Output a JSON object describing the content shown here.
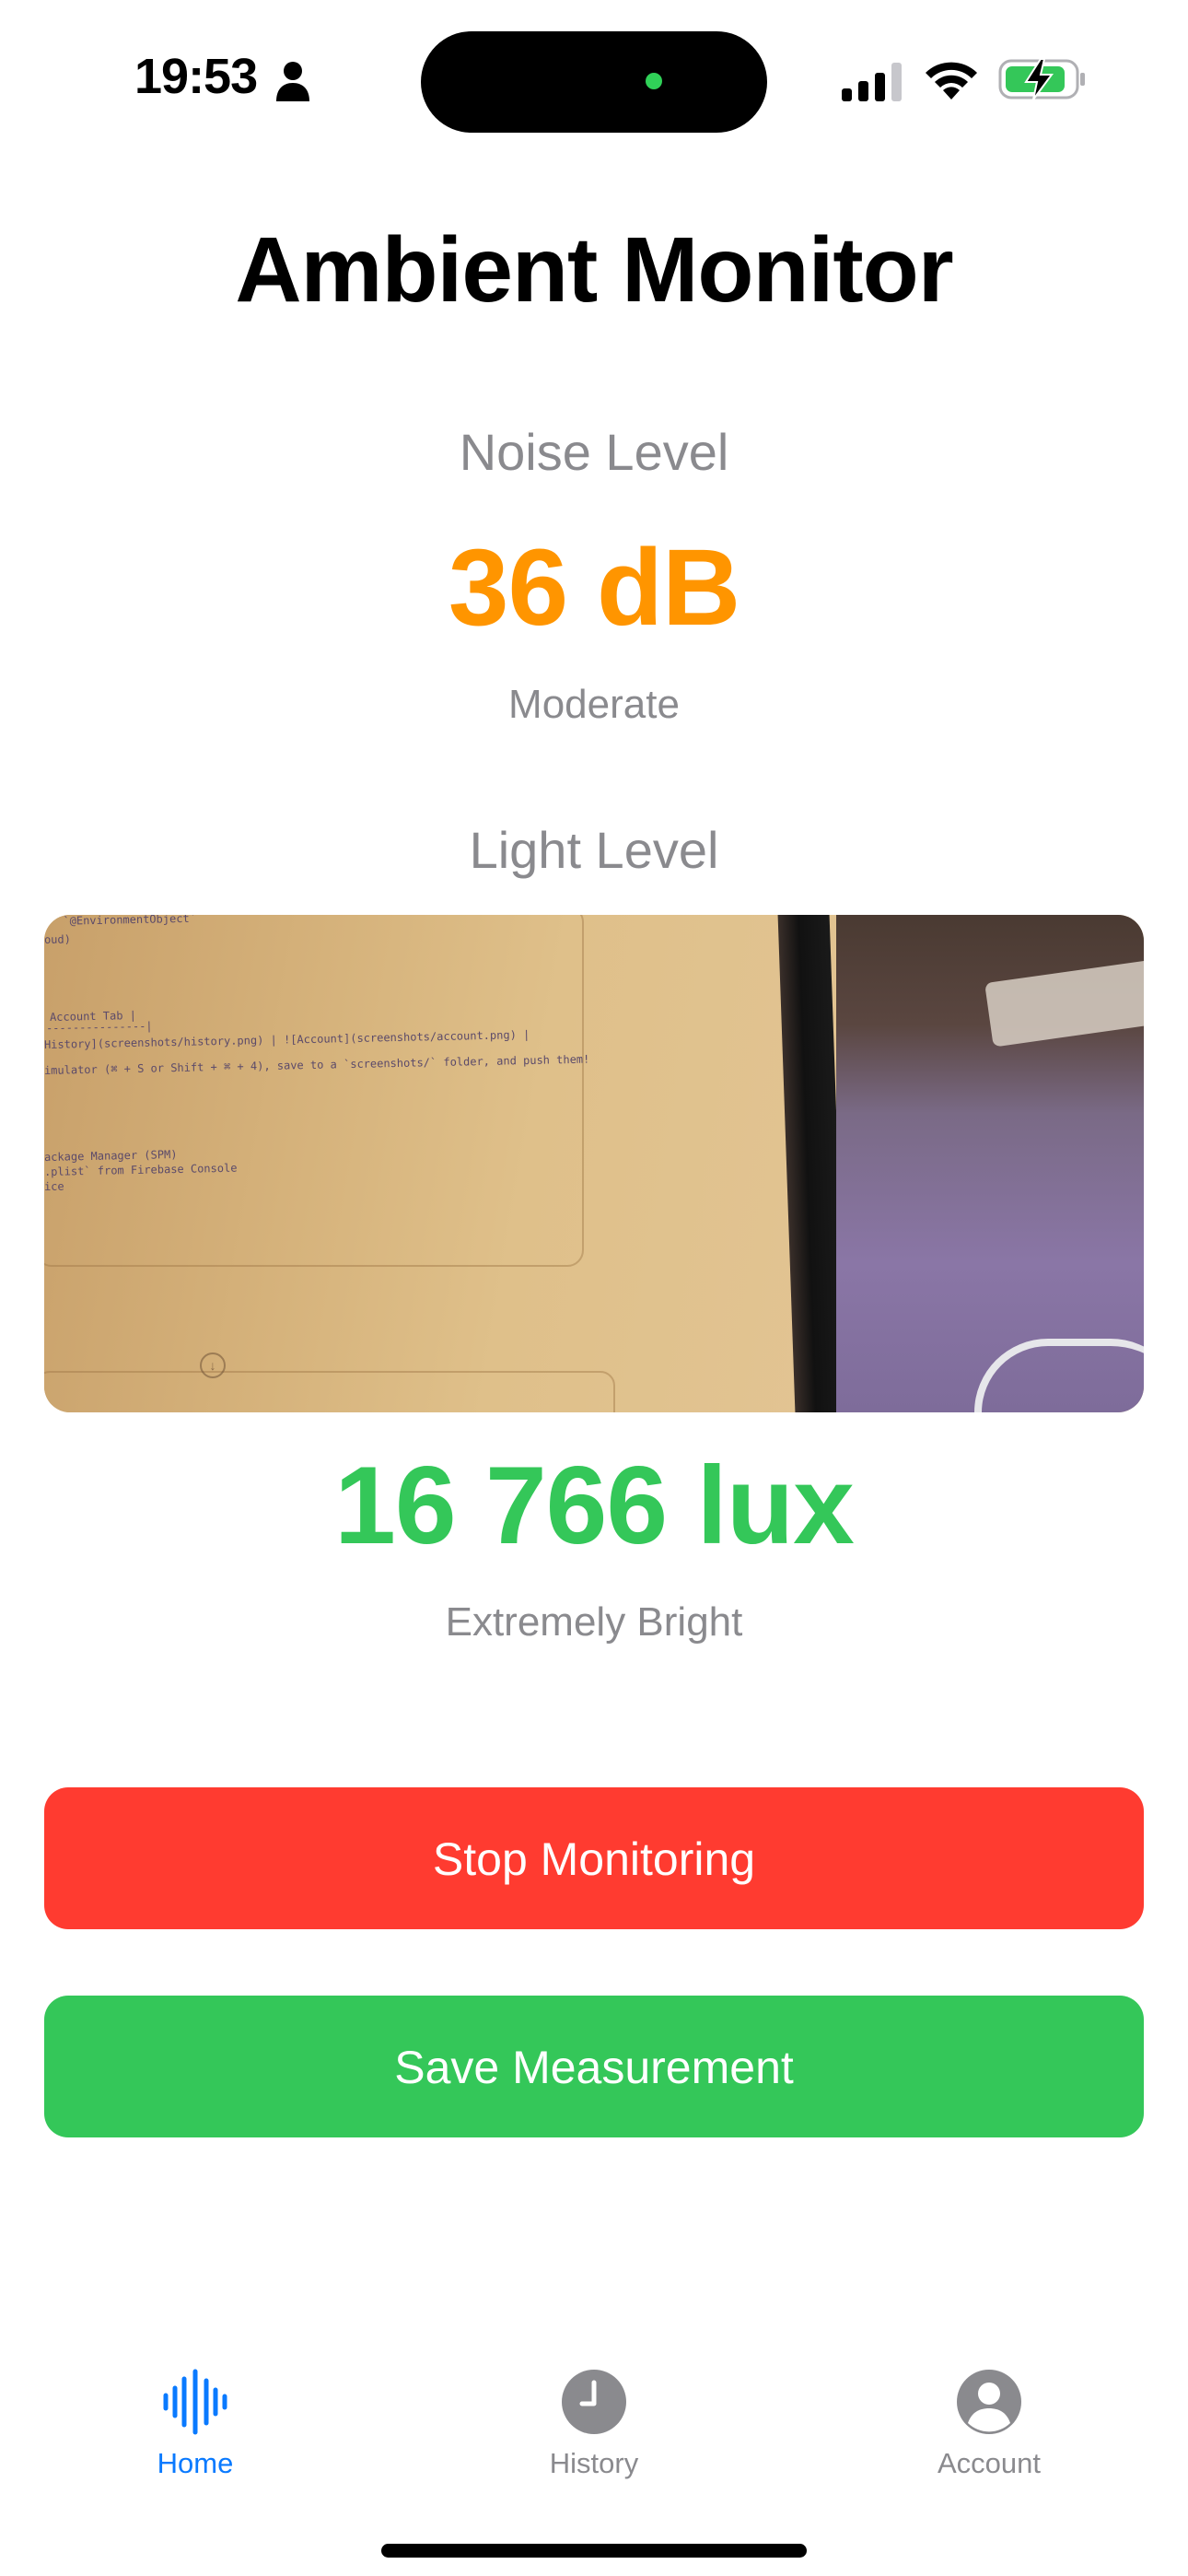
{
  "status_bar": {
    "time": "19:53",
    "icons": [
      "person-icon",
      "cellular-signal-icon",
      "wifi-icon",
      "battery-charging-icon"
    ]
  },
  "header": {
    "title": "Ambient Monitor"
  },
  "noise": {
    "label": "Noise Level",
    "value": "36 dB",
    "description": "Moderate",
    "color": "#ff9500"
  },
  "light": {
    "label": "Light Level",
    "value": "16 766 lux",
    "description": "Extremely Bright",
    "color": "#34c759"
  },
  "camera_preview": {
    "code_lines": [
      "` `@EnvironmentObject`",
      "oud)",
      "Account Tab |",
      "---------------|",
      "History](screenshots/history.png) | ![Account](screenshots/account.png) |",
      "imulator (⌘ + S or Shift + ⌘ + 4), save to a `screenshots/` folder, and push them!",
      "ackage Manager (SPM)",
      ".plist` from Firebase Console",
      "ice"
    ]
  },
  "actions": {
    "stop_label": "Stop Monitoring",
    "save_label": "Save Measurement",
    "stop_color": "#ff3b30",
    "save_color": "#34c759"
  },
  "tab_bar": {
    "tabs": [
      {
        "label": "Home",
        "icon": "waveform-icon",
        "selected": true
      },
      {
        "label": "History",
        "icon": "clock-icon",
        "selected": false
      },
      {
        "label": "Account",
        "icon": "person-circle-icon",
        "selected": false
      }
    ],
    "accent": "#0a7aff"
  }
}
